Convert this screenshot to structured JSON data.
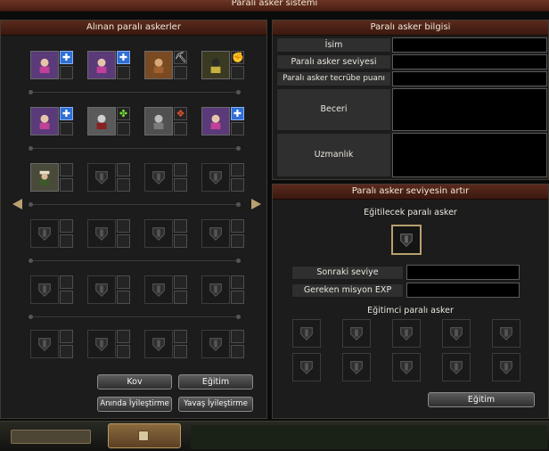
{
  "window": {
    "title": "Paralı asker sistemi"
  },
  "left_panel": {
    "header": "Alınan paralı askerler",
    "actions": {
      "kov": "Kov",
      "egitim": "Eğitim",
      "aninda": "Anında İyileştirme",
      "yavas": "Yavaş İyileştirme"
    }
  },
  "info_panel": {
    "header": "Paralı asker bilgisi",
    "rows": {
      "isim": "İsim",
      "seviye": "Paralı asker seviyesi",
      "tecrube": "Paralı asker tecrübe puanı",
      "beceri": "Beceri",
      "uzmanlik": "Uzmanlık"
    }
  },
  "level_panel": {
    "header": "Paralı asker seviyesin artır",
    "trainee_label": "Eğitilecek paralı asker",
    "next_level_label": "Sonraki seviye",
    "required_exp_label": "Gereken misyon EXP",
    "trainer_label": "Eğitimci paralı asker",
    "train_button": "Eğitim"
  },
  "colors": {
    "header": "#4a1f14",
    "panel": "#1c1c1c",
    "accent_gold": "#b8a070"
  }
}
